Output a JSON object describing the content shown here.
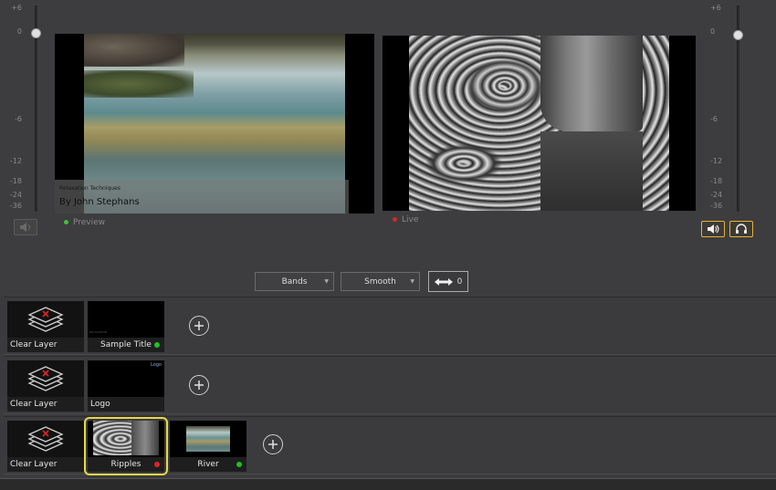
{
  "meters": {
    "left_scale": [
      "+6",
      "0",
      "-6",
      "-12",
      "-18",
      "-24",
      "-36"
    ],
    "right_scale": [
      "+6",
      "0",
      "-6",
      "-12",
      "-18",
      "-24",
      "-36"
    ]
  },
  "preview": {
    "status_label": "Preview",
    "status_color": "#3ec13e",
    "title_overlay_small": "Relaxation Techniques",
    "title_overlay_big": "By John Stephans"
  },
  "live": {
    "status_label": "Live",
    "status_color": "#d02a2a"
  },
  "toolbar": {
    "bands_label": "Bands",
    "smooth_label": "Smooth",
    "transition_value": "0"
  },
  "icons": {
    "mute": "speaker-muted-icon",
    "speaker": "speaker-icon",
    "headphones": "headphones-icon"
  },
  "layers": [
    {
      "clear_label": "Clear Layer",
      "items": [
        {
          "label": "Sample Title",
          "status_color": "#21c021",
          "thumb_text": "RELAXATION"
        }
      ]
    },
    {
      "clear_label": "Clear Layer",
      "items": [
        {
          "label": "Logo",
          "thumb_text": "Logo"
        }
      ]
    },
    {
      "clear_label": "Clear Layer",
      "items": [
        {
          "label": "Ripples",
          "status_color": "#e02525",
          "selected": true
        },
        {
          "label": "River",
          "status_color": "#21c021"
        }
      ]
    }
  ],
  "colors": {
    "accent": "#e6b23a",
    "selection": "#e6d84a"
  }
}
